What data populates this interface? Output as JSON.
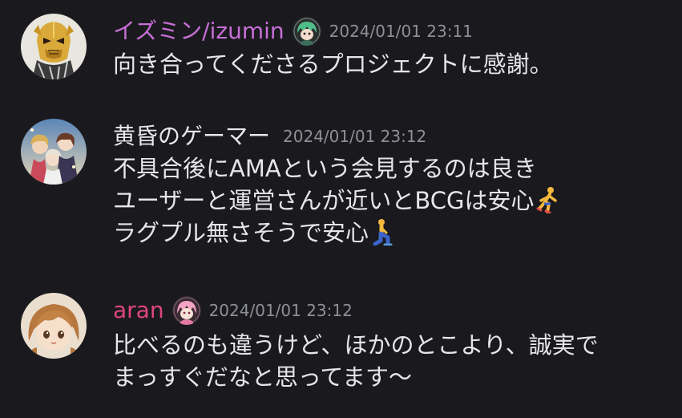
{
  "colors": {
    "background": "#1a1a1e",
    "text": "#e6e6ea",
    "timestamp": "#8e9097",
    "user1_name": "#c76fd6",
    "user2_name": "#e8e8ec",
    "user3_name": "#e0457e"
  },
  "messages": [
    {
      "username": "イズミン/izumin",
      "timestamp": "2024/01/01 23:11",
      "lines": [
        "向き合ってくださるプロジェクトに感謝。"
      ],
      "avatar_icon": "golden-helmet-avatar",
      "role_icon": "green-hair-character-icon"
    },
    {
      "username": "黄昏のゲーマー",
      "timestamp": "2024/01/01 23:12",
      "lines": [
        "不具合後にAMAという会見するのは良き",
        "ユーザーと運営さんが近いとBCGは安心",
        "ラグプル無さそうで安心"
      ],
      "avatar_icon": "anime-group-avatar",
      "emojis": [
        "running-person-emoji",
        "kneeling-person-emoji"
      ]
    },
    {
      "username": "aran",
      "timestamp": "2024/01/01 23:12",
      "lines": [
        "比べるのも違うけど、ほかのとこより、誠実で",
        "まっすぐだなと思ってます～"
      ],
      "avatar_icon": "brown-hair-girl-avatar",
      "role_icon": "pink-hair-character-icon"
    }
  ]
}
